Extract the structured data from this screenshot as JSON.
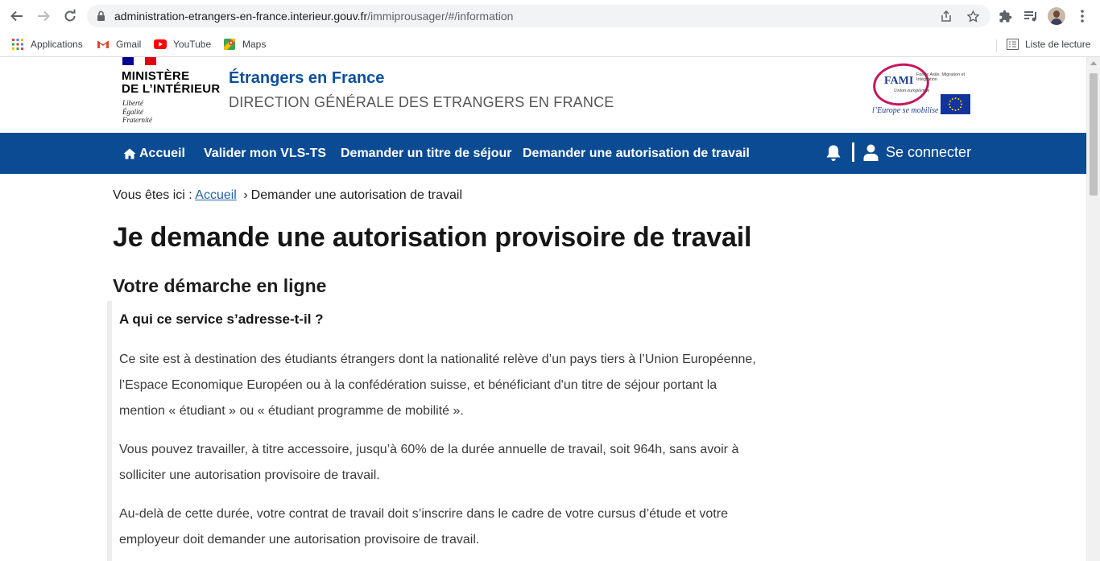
{
  "browser": {
    "url_host": "administration-etrangers-en-france.interieur.gouv.fr",
    "url_path": "/immiprousager/#/information",
    "bookmarks": [
      {
        "label": "Applications",
        "icon": "apps-grid-icon"
      },
      {
        "label": "Gmail",
        "icon": "gmail-icon"
      },
      {
        "label": "YouTube",
        "icon": "youtube-icon"
      },
      {
        "label": "Maps",
        "icon": "maps-icon"
      }
    ],
    "reading_list": "Liste de lecture"
  },
  "header": {
    "ministry_line1": "MINISTÈRE",
    "ministry_line2": "DE L’INTÉRIEUR",
    "motto": [
      "Liberté",
      "Égalité",
      "Fraternité"
    ],
    "site_title": "Étrangers en France",
    "site_subtitle": "DIRECTION GÉNÉRALE DES ETRANGERS EN FRANCE",
    "fami_logo": {
      "acronym": "FAMI",
      "description": "Fonds Asile, Migration et Intégration",
      "union": "Union européenne",
      "slogan": "l’Europe se mobilise"
    }
  },
  "navbar": {
    "home": "Accueil",
    "items": [
      "Valider mon VLS-TS",
      "Demander un titre de séjour",
      "Demander une autorisation de travail"
    ],
    "login": "Se connecter"
  },
  "breadcrumb": {
    "prefix": "Vous êtes ici :",
    "home": "Accueil",
    "separator": "›",
    "current": "Demander une autorisation de travail"
  },
  "content": {
    "title": "Je demande une autorisation provisoire de travail",
    "section_title": "Votre démarche en ligne",
    "box_question": "A qui ce service s’adresse-t-il ?",
    "paragraphs": [
      "Ce site est à destination des étudiants étrangers dont la nationalité relève d’un pays tiers à l’Union Européenne, l’Espace Economique Européen ou à la confédération suisse, et bénéficiant d'un titre de séjour portant la mention « étudiant » ou « étudiant programme de mobilité ».",
      "Vous pouvez travailler, à titre accessoire, jusqu’à 60% de la durée annuelle de travail, soit 964h, sans avoir à solliciter une autorisation provisoire de travail.",
      "Au-delà de cette durée, votre contrat de travail doit s’inscrire dans le cadre de votre cursus d’étude et votre employeur doit demander une autorisation provisoire de travail."
    ]
  },
  "colors": {
    "navbar": "#0a4b94",
    "site_title": "#0b4f9a",
    "link": "#2463a8"
  }
}
